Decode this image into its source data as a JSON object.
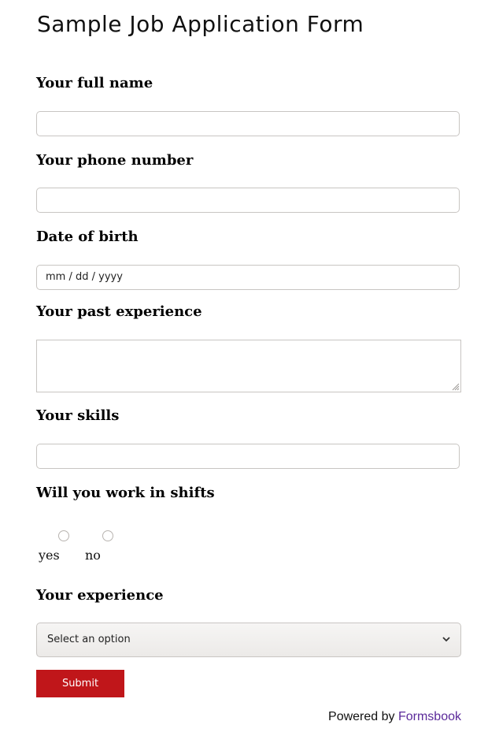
{
  "form": {
    "title": "Sample Job Application Form",
    "fields": {
      "full_name": {
        "label": "Your full name",
        "value": ""
      },
      "phone": {
        "label": "Your phone number",
        "value": ""
      },
      "dob": {
        "label": "Date of birth",
        "placeholder": "mm / dd / yyyy",
        "value": ""
      },
      "past_experience": {
        "label": "Your past experience",
        "value": ""
      },
      "skills": {
        "label": "Your skills",
        "value": ""
      },
      "shifts": {
        "label": "Will you work in shifts",
        "options": [
          {
            "label": "yes",
            "checked": false
          },
          {
            "label": "no",
            "checked": false
          }
        ]
      },
      "experience": {
        "label": "Your experience",
        "selected": "Select an option"
      }
    },
    "submit_label": "Submit"
  },
  "footer": {
    "powered_prefix": "Powered by",
    "brand": "Formsbook",
    "brand_color": "#5b2a9a"
  },
  "colors": {
    "accent": "#c0161a",
    "border": "#c8c5c2"
  }
}
